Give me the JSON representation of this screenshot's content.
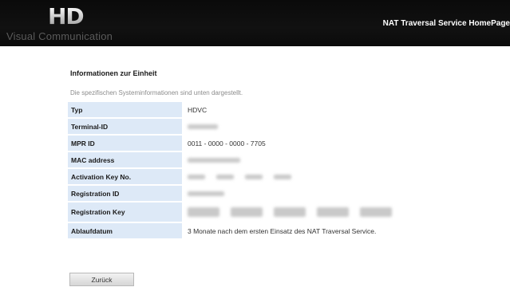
{
  "header": {
    "logo_mark": "HD",
    "logo_text": "Visual Communication",
    "nav_link": "NAT Traversal Service HomePage"
  },
  "page": {
    "title": "Informationen zur Einheit",
    "description": "Die spezifischen Systeminformationen sind unten dargestellt."
  },
  "table": {
    "rows": [
      {
        "label": "Typ",
        "value": "HDVC"
      },
      {
        "label": "Terminal-ID",
        "value": ""
      },
      {
        "label": "MPR ID",
        "value": "0011 - 0000 - 0000 - 7705"
      },
      {
        "label": "MAC address",
        "value": ""
      },
      {
        "label": "Activation Key No.",
        "value": ""
      },
      {
        "label": "Registration ID",
        "value": ""
      },
      {
        "label": "Registration Key",
        "value": ""
      },
      {
        "label": "Ablaufdatum",
        "value": "3 Monate nach dem ersten Einsatz des NAT Traversal Service."
      }
    ]
  },
  "buttons": {
    "back_label": "Zurück"
  }
}
